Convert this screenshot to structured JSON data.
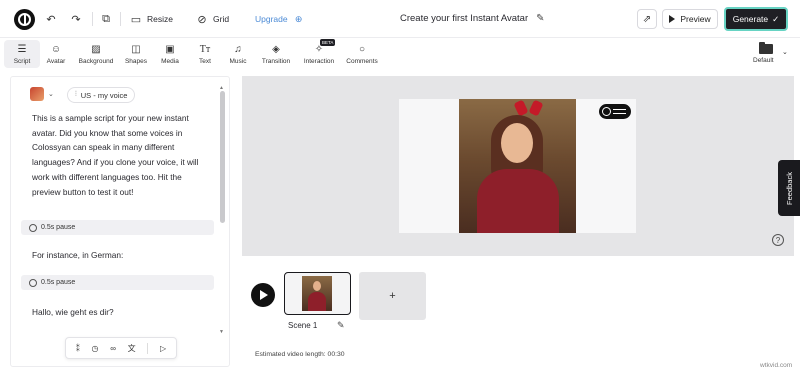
{
  "topbar": {
    "resize_label": "Resize",
    "grid_label": "Grid",
    "upgrade_label": "Upgrade",
    "document_title": "Create your first Instant Avatar",
    "preview_label": "Preview",
    "generate_label": "Generate",
    "accent_color": "#67d3c3",
    "upgrade_color": "#4c8bd6"
  },
  "tools": [
    {
      "label": "Script",
      "icon": "script-icon",
      "active": true
    },
    {
      "label": "Avatar",
      "icon": "avatar-icon"
    },
    {
      "label": "Background",
      "icon": "background-icon"
    },
    {
      "label": "Shapes",
      "icon": "shapes-icon"
    },
    {
      "label": "Media",
      "icon": "media-icon"
    },
    {
      "label": "Text",
      "icon": "text-icon"
    },
    {
      "label": "Music",
      "icon": "music-icon"
    },
    {
      "label": "Transition",
      "icon": "transition-icon"
    },
    {
      "label": "Interaction",
      "icon": "interaction-icon",
      "badge": "BETA"
    },
    {
      "label": "Comments",
      "icon": "comments-icon"
    }
  ],
  "brand_kit": {
    "label": "Default"
  },
  "script": {
    "voice_label": "US - my voice",
    "paragraph": "This is a sample script for your new instant avatar. Did you know that some voices in Colossyan can speak in many different languages? And if you clone your voice, it will work with different languages too. Hit the preview button to test it out!",
    "pause_1": "0.5s pause",
    "line_2": "For instance, in German:",
    "pause_2": "0.5s pause",
    "line_3": "Hallo, wie geht es dir?"
  },
  "feedback_label": "Feedback",
  "scenes": {
    "scene_1_label": "Scene 1",
    "add_label": "+",
    "estimated_length": "Estimated video length: 00:30"
  },
  "watermark": "wtkvid.com"
}
